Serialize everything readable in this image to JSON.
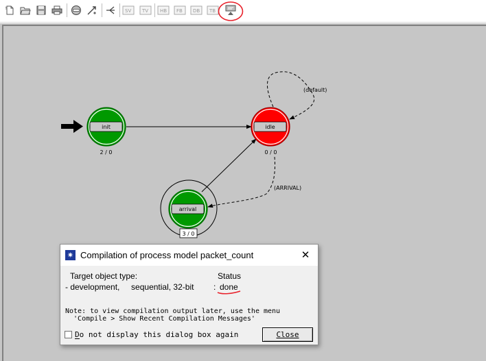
{
  "toolbar": {
    "buttons": [
      {
        "name": "new-document-icon"
      },
      {
        "name": "open-folder-icon"
      },
      {
        "name": "save-icon"
      },
      {
        "name": "print-icon"
      },
      {
        "name": "create-state-icon"
      },
      {
        "name": "create-transition-icon"
      },
      {
        "name": "fork-icon"
      },
      {
        "name": "state-variables-icon"
      },
      {
        "name": "temporary-variables-icon"
      },
      {
        "name": "header-block-icon"
      },
      {
        "name": "function-block-icon"
      },
      {
        "name": "diagnostic-block-icon"
      },
      {
        "name": "termination-block-icon"
      },
      {
        "name": "compile-process-model-icon"
      }
    ],
    "highlight_color": "#e8202a"
  },
  "diagram": {
    "states": [
      {
        "id": "init",
        "label": "init",
        "counter": "2 / 0",
        "color": "#009900",
        "kind": "forced",
        "initial": true
      },
      {
        "id": "idle",
        "label": "idle",
        "counter": "0 / 0",
        "color": "#ff0000",
        "kind": "unforced"
      },
      {
        "id": "arrival",
        "label": "arrival",
        "counter": "3 / 0",
        "color": "#009900",
        "kind": "forced"
      }
    ],
    "transitions": [
      {
        "from": "init",
        "to": "idle",
        "label": "",
        "style": "solid"
      },
      {
        "from": "idle",
        "to": "idle",
        "label": "(default)",
        "style": "dashed"
      },
      {
        "from": "idle",
        "to": "arrival",
        "label": "(ARRIVAL)",
        "style": "dashed"
      },
      {
        "from": "arrival",
        "to": "idle",
        "label": "",
        "style": "solid"
      }
    ]
  },
  "dialog": {
    "title": "Compilation of process model packet_count",
    "target_header": "Target object type:",
    "status_header": "Status",
    "target_row": "- development,     sequential, 32-bit",
    "colon": ":",
    "status_value": "done",
    "note_line1": "Note: to view compilation output later, use the menu",
    "note_line2": "  'Compile > Show Recent Compilation Messages'",
    "checkbox_label": "Do not display this dialog box again",
    "checkbox_checked": false,
    "close_label": "Close"
  }
}
